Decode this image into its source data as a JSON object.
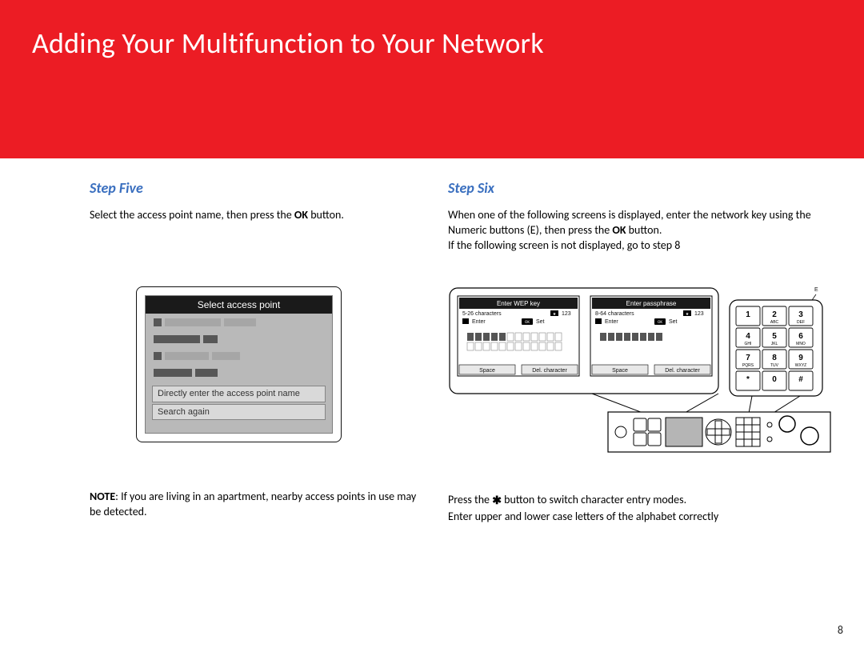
{
  "page": {
    "number": "8"
  },
  "header": {
    "title": "Adding Your Multifunction to Your Network"
  },
  "left": {
    "heading": "Step Five",
    "body_pre": "Select the access point name, then press the ",
    "body_ok": "OK",
    "body_post": " button.",
    "screen": {
      "title": "Select access point",
      "option_direct": "Directly enter the access point name",
      "option_search": "Search again"
    },
    "note_label": "NOTE",
    "note_body": ":  If you are living in an apartment, nearby access points in use may be detected."
  },
  "right": {
    "heading": "Step Six",
    "body_line1_pre": "When one of the following screens is displayed, enter the network key using the Numeric buttons (E), then press the ",
    "body_line1_ok": "OK",
    "body_line1_post": " button.",
    "body_line2": "If the following screen is not displayed, go to step 8",
    "labelE": "E",
    "screens": {
      "wep": {
        "title": "Enter WEP key",
        "charinfo": "5-26 characters",
        "mode": "123",
        "enter": "Enter",
        "set": "Set",
        "ok": "OK",
        "btnL": "Space",
        "btnR": "Del. character"
      },
      "pass": {
        "title": "Enter passphrase",
        "charinfo": "8-64 characters",
        "mode": "123",
        "enter": "Enter",
        "set": "Set",
        "ok": "OK",
        "btnL": "Space",
        "btnR": "Del. character"
      }
    },
    "keypad": [
      [
        "1",
        ""
      ],
      [
        "2",
        "ABC"
      ],
      [
        "3",
        "DEF"
      ],
      [
        "4",
        "GHI"
      ],
      [
        "5",
        "JKL"
      ],
      [
        "6",
        "MNO"
      ],
      [
        "7",
        "PQRS"
      ],
      [
        "8",
        "TUV"
      ],
      [
        "9",
        "WXYZ"
      ],
      [
        "*",
        ""
      ],
      [
        "0",
        ""
      ],
      [
        "#",
        ""
      ]
    ],
    "post_pre": "Press the  ",
    "post_post": "  button to switch character entry modes.",
    "post_line2": "Enter upper and lower case letters of the alphabet correctly"
  }
}
